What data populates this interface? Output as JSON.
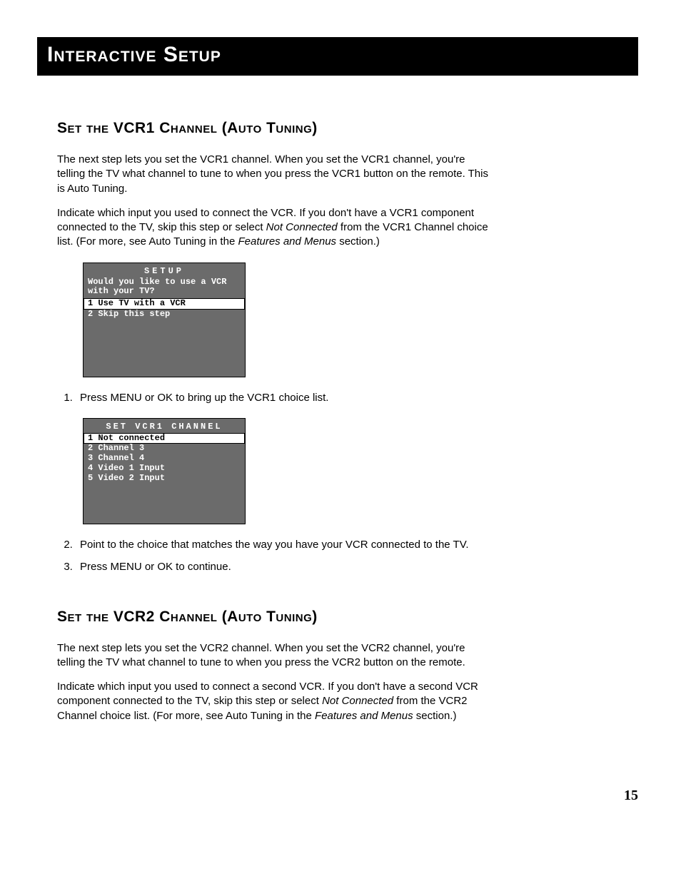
{
  "page_title": "Interactive Setup",
  "page_number": "15",
  "section1": {
    "heading": "Set the VCR1 Channel (Auto Tuning)",
    "para1": "The next step lets you set the VCR1 channel. When you set the VCR1 channel, you're telling the TV what channel to tune to when you press the VCR1 button on the remote. This is Auto Tuning.",
    "para2a": "Indicate which input you used to connect the VCR.  If you don't have a VCR1 component connected to the TV, skip this step or select ",
    "para2_i1": "Not Connected",
    "para2b": " from the VCR1 Channel choice list. (For more, see Auto Tuning in the ",
    "para2_i2": "Features and Menus",
    "para2c": " section.)",
    "osd1": {
      "title": "SETUP",
      "prompt": "Would you like to use a VCR with your TV?",
      "items": [
        {
          "n": "1",
          "label": "Use TV with a VCR",
          "selected": true
        },
        {
          "n": "2",
          "label": "Skip this step",
          "selected": false
        }
      ]
    },
    "step1": "Press MENU or OK to bring up the VCR1 choice list.",
    "osd2": {
      "title": "SET VCR1 CHANNEL",
      "items": [
        {
          "n": "1",
          "label": "Not connected",
          "selected": true
        },
        {
          "n": "2",
          "label": "Channel 3",
          "selected": false
        },
        {
          "n": "3",
          "label": "Channel 4",
          "selected": false
        },
        {
          "n": "4",
          "label": "Video 1 Input",
          "selected": false
        },
        {
          "n": "5",
          "label": "Video 2 Input",
          "selected": false
        }
      ]
    },
    "step2": "Point to the choice that matches the way you have your VCR connected to the TV.",
    "step3": "Press MENU or OK to continue."
  },
  "section2": {
    "heading": "Set the VCR2 Channel (Auto Tuning)",
    "para1": "The next step lets you set the VCR2 channel. When you set the VCR2 channel, you're telling the TV what channel to tune to when you press the VCR2 button on the remote.",
    "para2a": "Indicate which input you used to connect a second VCR.  If you don't have a second VCR component connected to the TV, skip this step or select ",
    "para2_i1": "Not Connected",
    "para2b": " from the VCR2 Channel choice list. (For more, see Auto Tuning in the ",
    "para2_i2": "Features and Menus",
    "para2c": " section.)"
  }
}
